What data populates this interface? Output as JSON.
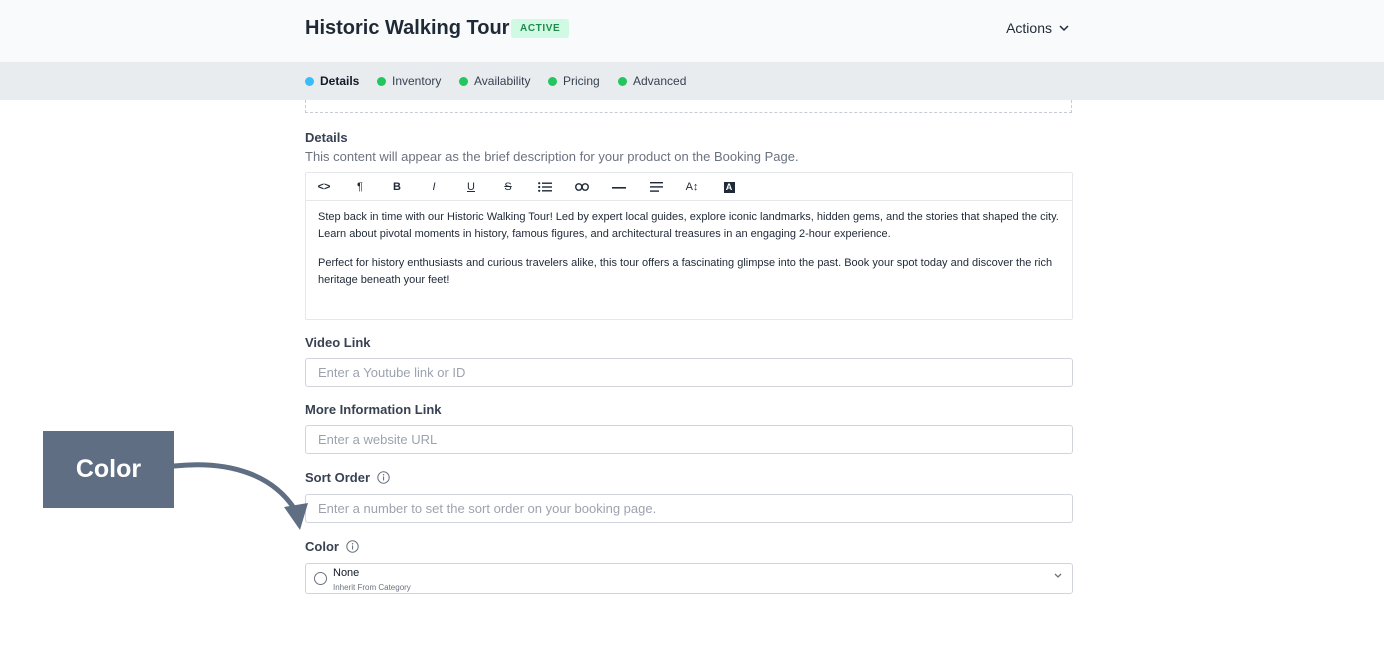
{
  "header": {
    "title": "Historic Walking Tour",
    "status_badge": "ACTIVE",
    "actions_label": "Actions"
  },
  "tabs": [
    {
      "label": "Details",
      "active": true,
      "color": "#38bdf8"
    },
    {
      "label": "Inventory",
      "active": false,
      "color": "#22c55e"
    },
    {
      "label": "Availability",
      "active": false,
      "color": "#22c55e"
    },
    {
      "label": "Pricing",
      "active": false,
      "color": "#22c55e"
    },
    {
      "label": "Advanced",
      "active": false,
      "color": "#22c55e"
    }
  ],
  "details": {
    "label": "Details",
    "help": "This content will appear as the brief description for your product on the Booking Page.",
    "toolbar_icons": [
      "code-icon",
      "paragraph-icon",
      "bold-icon",
      "italic-icon",
      "underline-icon",
      "strikethrough-icon",
      "bullet-list-icon",
      "link-icon",
      "horizontal-rule-icon",
      "align-icon",
      "text-size-icon",
      "text-color-icon"
    ],
    "toolbar_glyphs": {
      "code": "<>",
      "paragraph": "¶",
      "bold": "B",
      "italic": "I",
      "underline": "U",
      "strike": "S",
      "text_size": "A↕",
      "text_color": "A"
    },
    "paragraphs": [
      "Step back in time with our Historic Walking Tour! Led by expert local guides, explore iconic landmarks, hidden gems, and the stories that shaped the city. Learn about pivotal moments in history, famous figures, and architectural treasures in an engaging 2-hour experience.",
      "Perfect for history enthusiasts and curious travelers alike, this tour offers a fascinating glimpse into the past. Book your spot today and discover the rich heritage beneath your feet!"
    ]
  },
  "video_link": {
    "label": "Video Link",
    "placeholder": "Enter a Youtube link or ID",
    "value": ""
  },
  "more_info_link": {
    "label": "More Information Link",
    "placeholder": "Enter a website URL",
    "value": ""
  },
  "sort_order": {
    "label": "Sort Order",
    "placeholder": "Enter a number to set the sort order on your booking page.",
    "value": ""
  },
  "color": {
    "label": "Color",
    "selected": "None",
    "subtext": "Inherit From Category"
  },
  "callout": {
    "text": "Color",
    "color": "#5f6e82"
  }
}
